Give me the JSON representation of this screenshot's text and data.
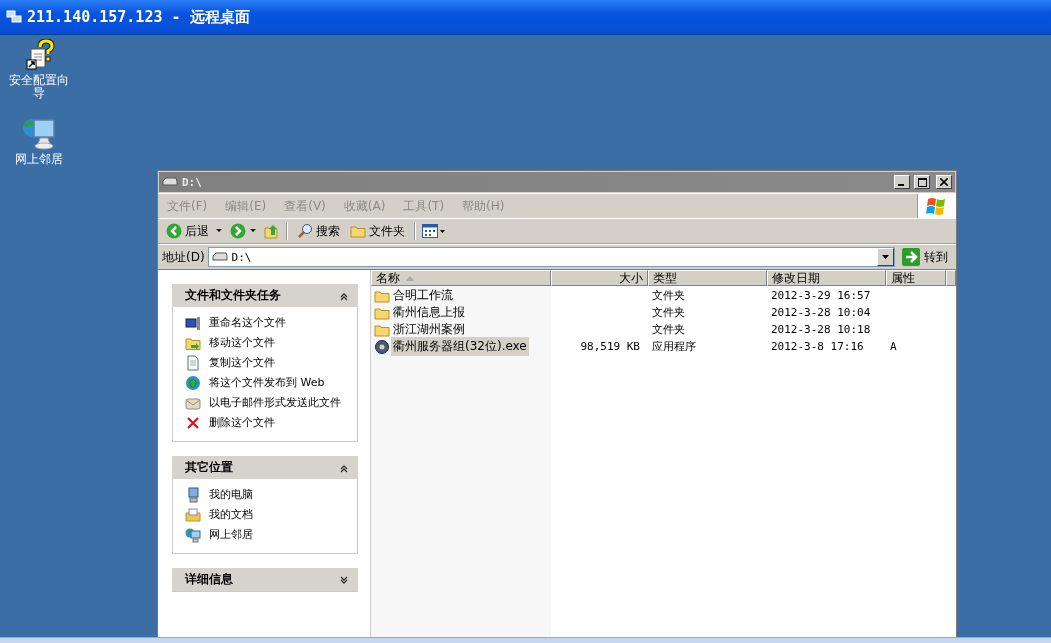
{
  "remote_window": {
    "title": "211.140.157.123 - 远程桌面"
  },
  "desktop_icons": [
    {
      "label": "安全配置向导",
      "kind": "wizard"
    },
    {
      "label": "网上邻居",
      "kind": "network"
    }
  ],
  "explorer": {
    "title": "D:\\",
    "menu": [
      "文件(F)",
      "编辑(E)",
      "查看(V)",
      "收藏(A)",
      "工具(T)",
      "帮助(H)"
    ],
    "toolbar": {
      "back": "后退",
      "search": "搜索",
      "folders": "文件夹"
    },
    "address": {
      "label": "地址(D)",
      "value": "D:\\",
      "go": "转到"
    },
    "task_panels": [
      {
        "title": "文件和文件夹任务",
        "expanded": true,
        "items": [
          {
            "label": "重命名这个文件",
            "kind": "rename"
          },
          {
            "label": "移动这个文件",
            "kind": "move"
          },
          {
            "label": "复制这个文件",
            "kind": "copy"
          },
          {
            "label": "将这个文件发布到 Web",
            "kind": "publish"
          },
          {
            "label": "以电子邮件形式发送此文件",
            "kind": "email"
          },
          {
            "label": "删除这个文件",
            "kind": "delete"
          }
        ]
      },
      {
        "title": "其它位置",
        "expanded": true,
        "items": [
          {
            "label": "我的电脑",
            "kind": "computer"
          },
          {
            "label": "我的文档",
            "kind": "documents"
          },
          {
            "label": "网上邻居",
            "kind": "network"
          }
        ]
      },
      {
        "title": "详细信息",
        "expanded": false
      }
    ],
    "columns": [
      {
        "label": "名称",
        "sorted": true
      },
      {
        "label": "大小",
        "sorted": false
      },
      {
        "label": "类型",
        "sorted": false
      },
      {
        "label": "修改日期",
        "sorted": false
      },
      {
        "label": "属性",
        "sorted": false
      }
    ],
    "rows": [
      {
        "name": "合明工作流",
        "kind": "folder",
        "type": "文件夹",
        "modified": "2012-3-29 16:57",
        "selected": false
      },
      {
        "name": "衢州信息上报",
        "kind": "folder",
        "type": "文件夹",
        "modified": "2012-3-28 10:04",
        "selected": false
      },
      {
        "name": "浙江湖州案例",
        "kind": "folder",
        "type": "文件夹",
        "modified": "2012-3-28 10:18",
        "selected": false
      },
      {
        "name": "衢州服务器组(32位).exe",
        "kind": "application",
        "size": "98,519 KB",
        "type": "应用程序",
        "modified": "2012-3-8 17:16",
        "attributes": "A",
        "selected": true
      }
    ]
  }
}
